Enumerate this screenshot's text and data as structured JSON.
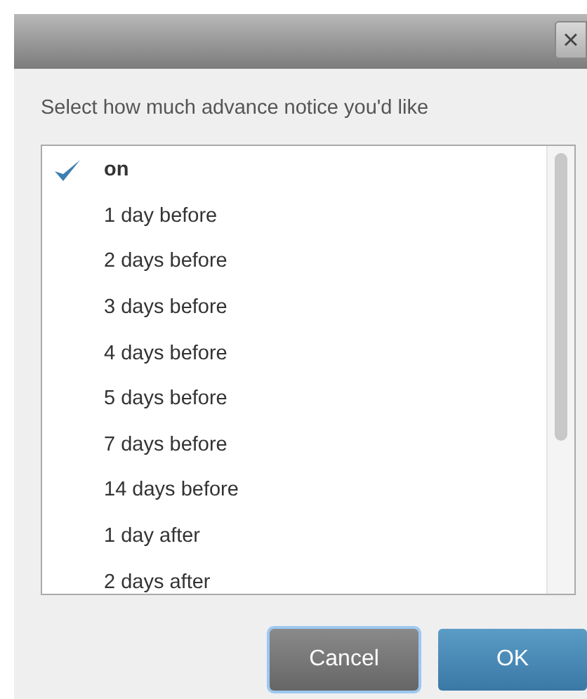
{
  "dialog": {
    "close": "×",
    "prompt": "Select how much advance notice you'd like",
    "options": [
      {
        "label": "on",
        "selected": true
      },
      {
        "label": "1 day before",
        "selected": false
      },
      {
        "label": "2 days before",
        "selected": false
      },
      {
        "label": "3 days before",
        "selected": false
      },
      {
        "label": "4 days before",
        "selected": false
      },
      {
        "label": "5 days before",
        "selected": false
      },
      {
        "label": "7 days before",
        "selected": false
      },
      {
        "label": "14 days before",
        "selected": false
      },
      {
        "label": "1 day after",
        "selected": false
      },
      {
        "label": "2 days after",
        "selected": false
      }
    ],
    "buttons": [
      {
        "label": "Cancel",
        "kind": "secondary"
      },
      {
        "label": "OK",
        "kind": "primary"
      }
    ]
  }
}
